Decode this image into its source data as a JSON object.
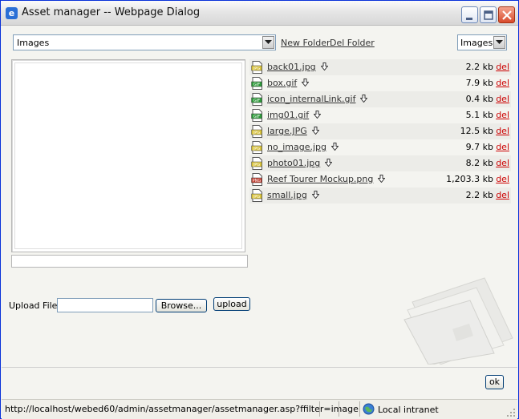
{
  "window": {
    "title": "Asset manager -- Webpage Dialog"
  },
  "toolbar": {
    "folder_selected": "Images",
    "new_folder_label": "New Folder",
    "del_folder_label": "Del Folder",
    "filter_selected": "Images"
  },
  "files": [
    {
      "name": "back01.jpg",
      "size": "2.2 kb",
      "type": "JPG",
      "del": "del"
    },
    {
      "name": "box.gif",
      "size": "7.9 kb",
      "type": "GIF",
      "del": "del"
    },
    {
      "name": "icon_internalLink.gif",
      "size": "0.4 kb",
      "type": "GIF",
      "del": "del"
    },
    {
      "name": "img01.gif",
      "size": "5.1 kb",
      "type": "GIF",
      "del": "del"
    },
    {
      "name": "large.JPG",
      "size": "12.5 kb",
      "type": "JPG",
      "del": "del"
    },
    {
      "name": "no_image.jpg",
      "size": "9.7 kb",
      "type": "JPG",
      "del": "del"
    },
    {
      "name": "photo01.jpg",
      "size": "8.2 kb",
      "type": "JPG",
      "del": "del"
    },
    {
      "name": "Reef Tourer Mockup.png",
      "size": "1,203.3 kb",
      "type": "PNG",
      "del": "del"
    },
    {
      "name": "small.jpg",
      "size": "2.2 kb",
      "type": "JPG",
      "del": "del"
    }
  ],
  "upload": {
    "label": "Upload File:",
    "browse_label": "Browse...",
    "upload_label": "upload"
  },
  "ok_label": "ok",
  "statusbar": {
    "url": "http://localhost/webed60/admin/assetmanager/assetmanager.asp?ffilter=image",
    "zone": "Local intranet"
  },
  "icon_colors": {
    "JPG": "#d8c23a",
    "GIF": "#2e9a3a",
    "PNG": "#c0392b"
  }
}
